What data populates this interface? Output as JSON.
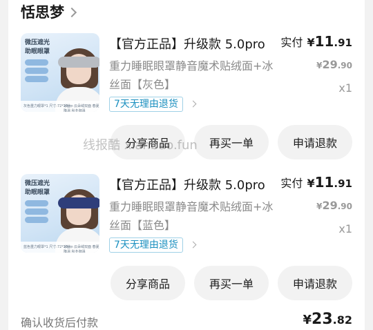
{
  "store": {
    "name": "恬思梦"
  },
  "items": [
    {
      "title": "【官方正品】升级款 5.0pro",
      "subtitle": "重力睡眠眼罩静音魔术贴绒面+冰丝面【灰色】",
      "tag": "7天无理由退货",
      "price_label": "实付",
      "price_currency": "¥",
      "price_int": "11",
      "price_dec": ".91",
      "orig_currency": "¥",
      "orig_int": "29",
      "orig_dec": ".90",
      "qty": "x1",
      "thumb": {
        "title": "微压遮光 助眠眼罩",
        "foot_left": "灰色重力眼罩*1 尺寸:72*13cm",
        "foot_right": "冰丝、云朵绒双面 春夏降温 秋冬御温"
      },
      "actions": [
        "分享商品",
        "再买一单",
        "申请退款"
      ]
    },
    {
      "title": "【官方正品】升级款 5.0pro",
      "subtitle": "重力睡眠眼罩静音魔术贴绒面+冰丝面【蓝色】",
      "tag": "7天无理由退货",
      "price_label": "实付",
      "price_currency": "¥",
      "price_int": "11",
      "price_dec": ".91",
      "orig_currency": "¥",
      "orig_int": "29",
      "orig_dec": ".90",
      "qty": "x1",
      "thumb": {
        "title": "微压遮光 助眠眼罩",
        "foot_left": "蓝色重力眼罩*1 尺寸:72*13cm",
        "foot_right": "冰丝、云朵绒双面 春夏降温 秋冬御温"
      },
      "actions": [
        "分享商品",
        "再买一单",
        "申请退款"
      ]
    }
  ],
  "footer": {
    "status": "确认收货后付款",
    "total_currency": "¥",
    "total_int": "23",
    "total_dec": ".82"
  },
  "watermark": "线报酷 xianbao.fun",
  "colors": {
    "tag_text": "#1a8fbf",
    "tag_border": "#9fd0e6",
    "button_bg": "#f2f2f2",
    "gray_mask": "#b8bcc2",
    "blue_mask": "#2f3e7a"
  }
}
